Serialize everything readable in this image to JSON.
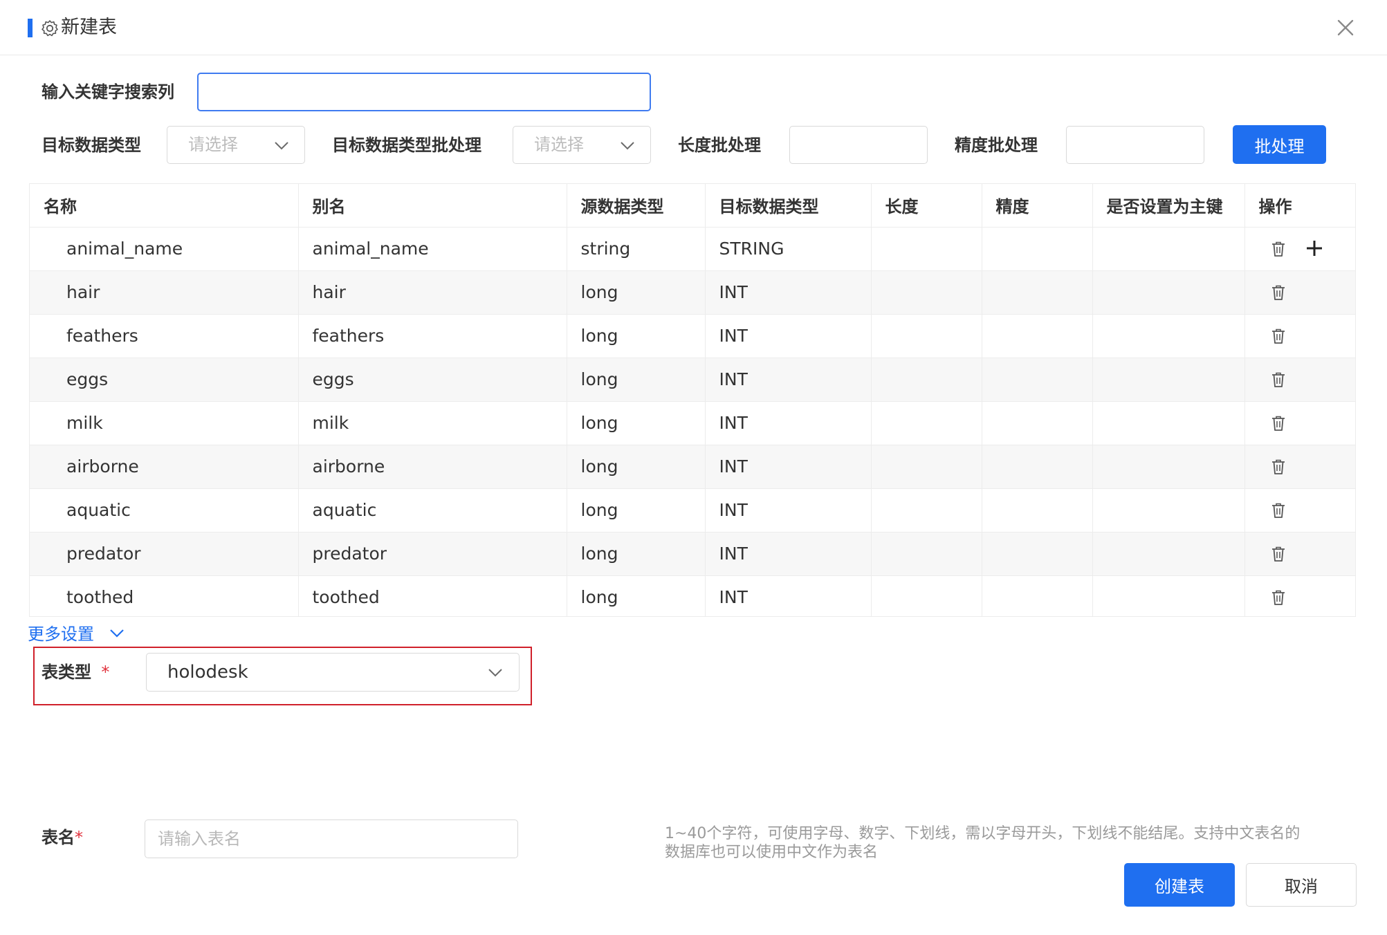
{
  "dialog": {
    "title": "新建表",
    "close_label": "×"
  },
  "search": {
    "label": "输入关键字搜索列",
    "value": "",
    "placeholder": ""
  },
  "batch": {
    "target_type_label": "目标数据类型",
    "target_type_placeholder": "请选择",
    "target_type_batch_label": "目标数据类型批处理",
    "target_type_batch_placeholder": "请选择",
    "length_batch_label": "长度批处理",
    "length_batch_value": "",
    "precision_batch_label": "精度批处理",
    "precision_batch_value": "",
    "batch_button_label": "批处理"
  },
  "table": {
    "columns": [
      "名称",
      "别名",
      "源数据类型",
      "目标数据类型",
      "长度",
      "精度",
      "是否设置为主键",
      "操作"
    ],
    "rows": [
      {
        "name": "animal_name",
        "alias": "animal_name",
        "source_type": "string",
        "target_type": "STRING",
        "length": "",
        "precision": "",
        "primary_key": ""
      },
      {
        "name": "hair",
        "alias": "hair",
        "source_type": "long",
        "target_type": "INT",
        "length": "",
        "precision": "",
        "primary_key": ""
      },
      {
        "name": "feathers",
        "alias": "feathers",
        "source_type": "long",
        "target_type": "INT",
        "length": "",
        "precision": "",
        "primary_key": ""
      },
      {
        "name": "eggs",
        "alias": "eggs",
        "source_type": "long",
        "target_type": "INT",
        "length": "",
        "precision": "",
        "primary_key": ""
      },
      {
        "name": "milk",
        "alias": "milk",
        "source_type": "long",
        "target_type": "INT",
        "length": "",
        "precision": "",
        "primary_key": ""
      },
      {
        "name": "airborne",
        "alias": "airborne",
        "source_type": "long",
        "target_type": "INT",
        "length": "",
        "precision": "",
        "primary_key": ""
      },
      {
        "name": "aquatic",
        "alias": "aquatic",
        "source_type": "long",
        "target_type": "INT",
        "length": "",
        "precision": "",
        "primary_key": ""
      },
      {
        "name": "predator",
        "alias": "predator",
        "source_type": "long",
        "target_type": "INT",
        "length": "",
        "precision": "",
        "primary_key": ""
      },
      {
        "name": "toothed",
        "alias": "toothed",
        "source_type": "long",
        "target_type": "INT",
        "length": "",
        "precision": "",
        "primary_key": ""
      }
    ]
  },
  "more_settings": {
    "label": "更多设置"
  },
  "table_type": {
    "label": "表类型",
    "required_mark": "*",
    "value": "holodesk"
  },
  "table_name": {
    "label": "表名",
    "required_mark": "*",
    "placeholder": "请输入表名",
    "value": "",
    "hint_line1": "1~40个字符，可使用字母、数字、下划线，需以字母开头，下划线不能结尾。支持中文表名的",
    "hint_line2": "数据库也可以使用中文作为表名"
  },
  "footer": {
    "create_label": "创建表",
    "cancel_label": "取消"
  },
  "colors": {
    "accent": "#1f6ff0",
    "highlight_border": "#d0202a",
    "required": "#e0303b"
  },
  "icons": {
    "title": "settings-gear-icon",
    "close": "close-icon",
    "select_arrow": "chevron-down-icon",
    "row_delete": "trash-icon",
    "row_add": "plus-icon"
  }
}
